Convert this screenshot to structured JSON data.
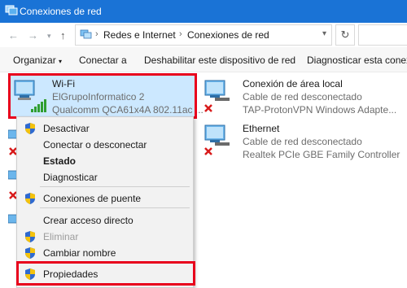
{
  "window": {
    "title": "Conexiones de red"
  },
  "address": {
    "breadcrumb": [
      "Redes e Internet",
      "Conexiones de red"
    ],
    "sep": "›"
  },
  "toolbar": {
    "organize": "Organizar",
    "organize_arrow": "▾",
    "connect": "Conectar a",
    "disable": "Deshabilitar este dispositivo de red",
    "diagnose": "Diagnosticar esta conexión"
  },
  "adapters": [
    {
      "name": "Wi-Fi",
      "line1": "ElGrupoInformatico 2",
      "line2": "Qualcomm QCA61x4A 802.11ac ..."
    },
    {
      "name": "Conexión de área local",
      "line1": "Cable de red desconectado",
      "line2": "TAP-ProtonVPN Windows Adapte..."
    },
    {
      "name": "Ethernet",
      "line1": "Cable de red desconectado",
      "line2": "Realtek PCIe GBE Family Controller"
    }
  ],
  "context_menu": {
    "items": [
      {
        "label": "Desactivar"
      },
      {
        "label": "Conectar o desconectar"
      },
      {
        "label": "Estado"
      },
      {
        "label": "Diagnosticar"
      },
      {
        "label": "Conexiones de puente"
      },
      {
        "label": "Crear acceso directo"
      },
      {
        "label": "Eliminar"
      },
      {
        "label": "Cambiar nombre"
      },
      {
        "label": "Propiedades"
      }
    ]
  },
  "colors": {
    "titlebar": "#1a73d6",
    "selection": "#cce8ff",
    "highlight": "#e8001c"
  },
  "icons": [
    "network-adapter-icon",
    "wifi-signal-icon",
    "disconnected-x-icon",
    "uac-shield-icon",
    "refresh-icon"
  ]
}
